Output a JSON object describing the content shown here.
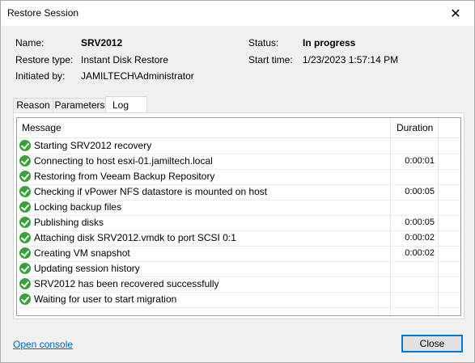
{
  "window": {
    "title": "Restore Session",
    "close_glyph": "✕"
  },
  "info": {
    "name_label": "Name:",
    "name_value": "SRV2012",
    "restore_type_label": "Restore type:",
    "restore_type_value": "Instant Disk Restore",
    "initiated_by_label": "Initiated by:",
    "initiated_by_value": "JAMILTECH\\Administrator",
    "status_label": "Status:",
    "status_value": "In progress",
    "start_time_label": "Start time:",
    "start_time_value": "1/23/2023 1:57:14 PM"
  },
  "tabs": [
    {
      "label": "Reason"
    },
    {
      "label": "Parameters"
    },
    {
      "label": "Log",
      "active": true
    }
  ],
  "log": {
    "columns": {
      "message": "Message",
      "duration": "Duration"
    },
    "rows": [
      {
        "message": "Starting SRV2012 recovery",
        "duration": ""
      },
      {
        "message": "Connecting to host esxi-01.jamiltech.local",
        "duration": "0:00:01"
      },
      {
        "message": "Restoring from Veeam Backup Repository",
        "duration": ""
      },
      {
        "message": "Checking if vPower NFS datastore is mounted on host",
        "duration": "0:00:05"
      },
      {
        "message": "Locking backup files",
        "duration": ""
      },
      {
        "message": "Publishing disks",
        "duration": "0:00:05"
      },
      {
        "message": "Attaching disk SRV2012.vmdk to port SCSI 0:1",
        "duration": "0:00:02"
      },
      {
        "message": "Creating VM snapshot",
        "duration": "0:00:02"
      },
      {
        "message": "Updating session history",
        "duration": ""
      },
      {
        "message": "SRV2012 has been recovered successfully",
        "duration": ""
      },
      {
        "message": "Waiting for user to start migration",
        "duration": ""
      }
    ],
    "status_icon": "success-check-icon",
    "status_color": "#3aa13a"
  },
  "footer": {
    "open_console": "Open console",
    "close_button": "Close"
  }
}
